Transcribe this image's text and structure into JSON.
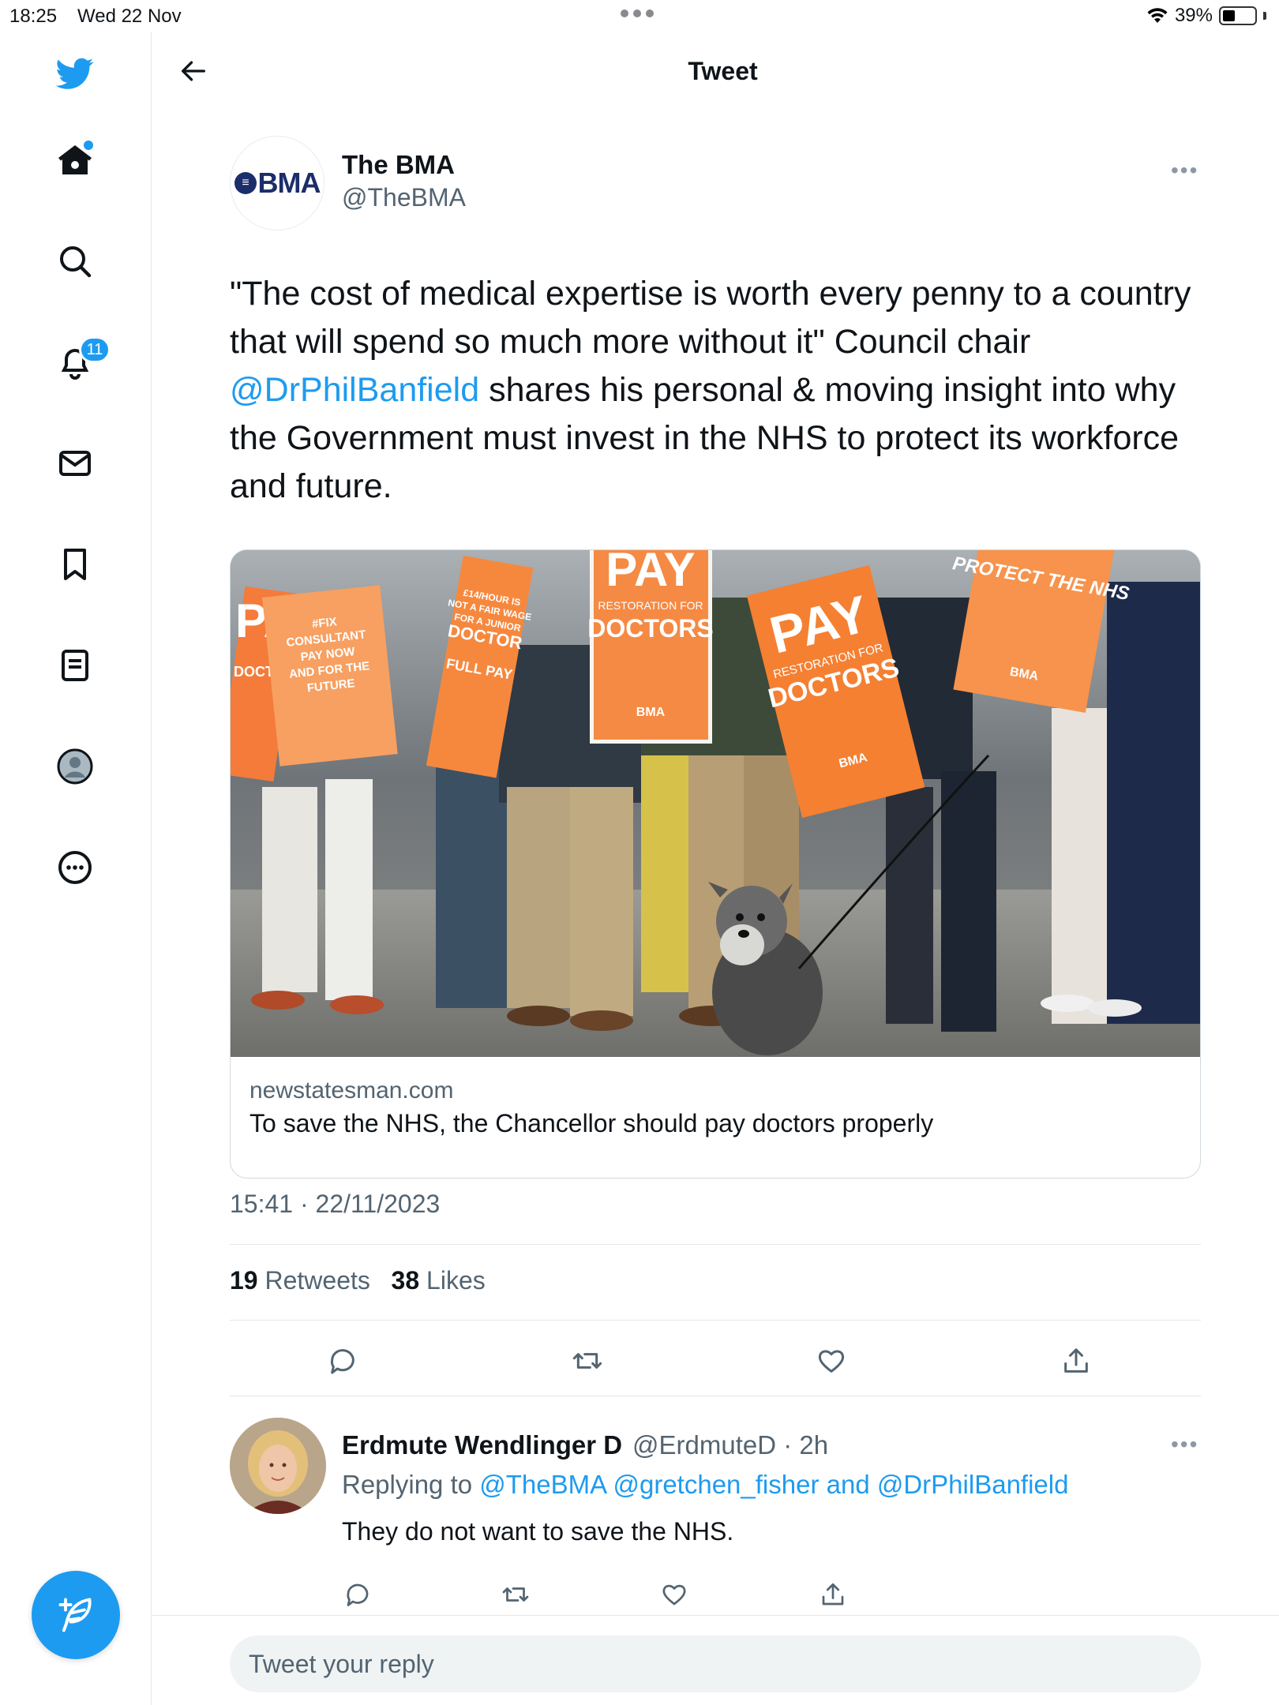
{
  "status_bar": {
    "time": "18:25",
    "date": "Wed 22 Nov",
    "battery": "39%",
    "battery_level": 0.39
  },
  "sidebar": {
    "items": [
      {
        "name": "twitter-logo",
        "icon": "bird"
      },
      {
        "name": "home",
        "icon": "home"
      },
      {
        "name": "explore",
        "icon": "search"
      },
      {
        "name": "notifications",
        "icon": "bell",
        "badge": "11"
      },
      {
        "name": "messages",
        "icon": "envelope"
      },
      {
        "name": "bookmarks",
        "icon": "bookmark"
      },
      {
        "name": "lists",
        "icon": "list"
      },
      {
        "name": "profile",
        "icon": "person"
      },
      {
        "name": "more",
        "icon": "ellipsis-circle"
      }
    ],
    "compose_icon": "feather-plus"
  },
  "header": {
    "title": "Tweet"
  },
  "tweet": {
    "author_name": "The BMA",
    "author_handle": "@TheBMA",
    "avatar_text": "BMA",
    "text_before": "\"The cost of medical expertise is worth every penny to a country that will spend so much more without it\" Council chair ",
    "mention": "@DrPhilBanfield",
    "text_after": " shares his personal & moving insight into why the Government must invest in the NHS to protect its workforce and future.",
    "card": {
      "image_signs": {
        "sign_pa": "PA",
        "sign_doctors_left": "DOCTORS",
        "sign_consultant": "#FIX CONSULTANT PAY NOW AND FOR THE FUTURE",
        "sign_junior": "£14/HOUR IS NOT A FAIR WAGE FOR A JUNIOR DOCTOR",
        "sign_full_pay": "FULL PAY RESTORATION NOW",
        "sign_pay": "PAY",
        "sign_restoration": "RESTORATION FOR",
        "sign_doctors": "DOCTORS",
        "sign_bma": "BMA",
        "sign_protect": "PROTECT THE NHS"
      },
      "domain": "newstatesman.com",
      "title": "To save the NHS, the Chancellor should pay doctors properly"
    },
    "timestamp": "15:41 · 22/11/2023",
    "retweets_count": "19",
    "retweets_label": "Retweets",
    "likes_count": "38",
    "likes_label": "Likes"
  },
  "reply": {
    "author_name": "Erdmute Wendlinger D",
    "author_handle": "@ErdmuteD · 2h",
    "replying_prefix": "Replying to ",
    "replying_mentions": "@TheBMA @gretchen_fisher and @DrPhilBanfield",
    "text": "They do not want to save the NHS."
  },
  "reply_box": {
    "placeholder": "Tweet your reply"
  },
  "colors": {
    "accent": "#1d9bf0",
    "text": "#0f1419",
    "secondary": "#536471",
    "border": "#e1e8ed",
    "sign_orange": "#f47b3a"
  }
}
